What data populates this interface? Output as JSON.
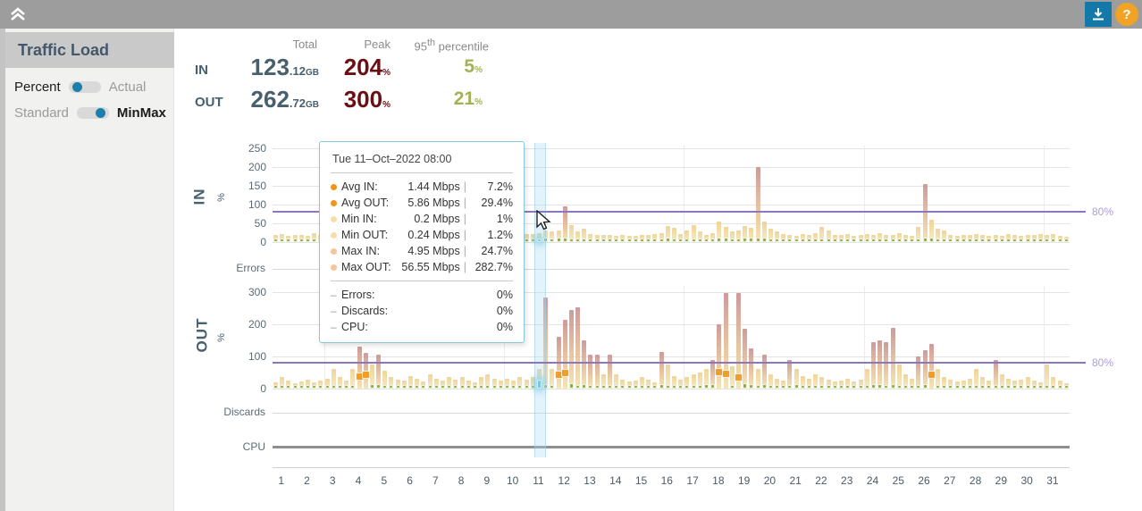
{
  "topbar": {
    "collapse_icon": "chevrons-up",
    "download_icon": "download",
    "help_label": "?"
  },
  "sidebar": {
    "title": "Traffic Load",
    "toggles": [
      {
        "left": "Percent",
        "right": "Actual",
        "selected": "left"
      },
      {
        "left": "Standard",
        "right": "MinMax",
        "selected": "right"
      }
    ]
  },
  "stats": {
    "columns": [
      "Total",
      "Peak",
      "95th percentile"
    ],
    "rows": [
      {
        "label": "IN",
        "total_int": "123",
        "total_frac": ".12",
        "total_unit": "GB",
        "peak": "204",
        "peak_unit": "%",
        "pct95": "5",
        "pct95_unit": "%"
      },
      {
        "label": "OUT",
        "total_int": "262",
        "total_frac": ".72",
        "total_unit": "GB",
        "peak": "300",
        "peak_unit": "%",
        "pct95": "21",
        "pct95_unit": "%"
      }
    ]
  },
  "tooltip": {
    "title": "Tue 11–Oct–2022 08:00",
    "rows": [
      {
        "marker": "avg",
        "label": "Avg IN:",
        "value": "1.44 Mbps",
        "pct": "7.2%"
      },
      {
        "marker": "avg",
        "label": "Avg OUT:",
        "value": "5.86 Mbps",
        "pct": "29.4%"
      },
      {
        "marker": "min",
        "label": "Min IN:",
        "value": "0.2 Mbps",
        "pct": "1%"
      },
      {
        "marker": "min",
        "label": "Min OUT:",
        "value": "0.24 Mbps",
        "pct": "1.2%"
      },
      {
        "marker": "max",
        "label": "Max IN:",
        "value": "4.95 Mbps",
        "pct": "24.7%"
      },
      {
        "marker": "max",
        "label": "Max OUT:",
        "value": "56.55 Mbps",
        "pct": "282.7%"
      }
    ],
    "footer_rows": [
      {
        "label": "Errors:",
        "pct": "0%"
      },
      {
        "label": "Discards:",
        "pct": "0%"
      },
      {
        "label": "CPU:",
        "pct": "0%"
      }
    ]
  },
  "chart_data": {
    "type": "bar",
    "title": "Traffic Load IN/OUT percent of interface capacity, October 2022",
    "days": [
      1,
      2,
      3,
      4,
      5,
      6,
      7,
      8,
      9,
      10,
      11,
      12,
      13,
      14,
      15,
      16,
      17,
      18,
      19,
      20,
      21,
      22,
      23,
      24,
      25,
      26,
      27,
      28,
      29,
      30,
      31
    ],
    "weekly_gridline_days": [
      3,
      10,
      17,
      24,
      31
    ],
    "slots_per_day": 4,
    "highlight_slot": 41,
    "threshold_pct": 80,
    "threshold_label": "80%",
    "in": {
      "axis_label": "IN",
      "axis_unit": "%",
      "ticks": [
        250,
        200,
        150,
        100,
        50,
        0
      ],
      "ylim": [
        0,
        262
      ],
      "avg_pct_per_day": [
        [
          8,
          9,
          8,
          10
        ],
        [
          9,
          8,
          10,
          9
        ],
        [
          8,
          10,
          9,
          8
        ],
        [
          10,
          12,
          11,
          9
        ],
        [
          9,
          8,
          9,
          10
        ],
        [
          8,
          9,
          8,
          9
        ],
        [
          10,
          9,
          8,
          9
        ],
        [
          9,
          10,
          9,
          8
        ],
        [
          8,
          9,
          10,
          9
        ],
        [
          9,
          8,
          9,
          10
        ],
        [
          9,
          8,
          12,
          10
        ],
        [
          11,
          13,
          10,
          9
        ],
        [
          10,
          9,
          8,
          9
        ],
        [
          9,
          8,
          9,
          8
        ],
        [
          8,
          9,
          8,
          10
        ],
        [
          9,
          11,
          10,
          8
        ],
        [
          9,
          10,
          9,
          8
        ],
        [
          10,
          12,
          11,
          9
        ],
        [
          10,
          11,
          13,
          12
        ],
        [
          11,
          9,
          8,
          9
        ],
        [
          9,
          8,
          9,
          8
        ],
        [
          8,
          10,
          9,
          8
        ],
        [
          9,
          8,
          8,
          9
        ],
        [
          9,
          10,
          9,
          8
        ],
        [
          10,
          9,
          8,
          9
        ],
        [
          10,
          13,
          11,
          9
        ],
        [
          9,
          8,
          9,
          8
        ],
        [
          8,
          9,
          10,
          8
        ],
        [
          9,
          8,
          9,
          8
        ],
        [
          8,
          9,
          8,
          9
        ],
        [
          9,
          8,
          10,
          8
        ]
      ],
      "max_pct_per_day": [
        [
          18,
          22,
          16,
          20
        ],
        [
          20,
          17,
          23,
          19
        ],
        [
          17,
          25,
          20,
          16
        ],
        [
          25,
          45,
          35,
          22
        ],
        [
          20,
          16,
          19,
          22
        ],
        [
          16,
          20,
          17,
          21
        ],
        [
          22,
          18,
          16,
          19
        ],
        [
          19,
          30,
          21,
          16
        ],
        [
          17,
          21,
          24,
          18
        ],
        [
          20,
          16,
          19,
          22
        ],
        [
          22,
          25,
          32,
          28
        ],
        [
          30,
          95,
          45,
          28
        ],
        [
          35,
          22,
          18,
          20
        ],
        [
          19,
          16,
          20,
          17
        ],
        [
          16,
          20,
          18,
          22
        ],
        [
          25,
          42,
          38,
          22
        ],
        [
          30,
          45,
          28,
          20
        ],
        [
          25,
          55,
          40,
          28
        ],
        [
          30,
          42,
          38,
          200
        ],
        [
          55,
          35,
          28,
          22
        ],
        [
          20,
          17,
          21,
          18
        ],
        [
          25,
          40,
          30,
          20
        ],
        [
          18,
          21,
          17,
          20
        ],
        [
          22,
          18,
          24,
          19
        ],
        [
          20,
          23,
          18,
          16
        ],
        [
          40,
          155,
          60,
          35
        ],
        [
          30,
          20,
          17,
          19
        ],
        [
          18,
          22,
          19,
          16
        ],
        [
          20,
          17,
          21,
          18
        ],
        [
          16,
          20,
          18,
          21
        ],
        [
          19,
          22,
          17,
          15
        ]
      ]
    },
    "out": {
      "axis_label": "OUT",
      "axis_unit": "%",
      "ticks": [
        300,
        200,
        100,
        0
      ],
      "ylim": [
        0,
        320
      ],
      "avg_pct_per_day": [
        [
          9,
          10,
          9,
          11
        ],
        [
          10,
          9,
          11,
          10
        ],
        [
          9,
          12,
          10,
          9
        ],
        [
          12,
          50,
          55,
          14
        ],
        [
          15,
          10,
          9,
          11
        ],
        [
          9,
          11,
          10,
          9
        ],
        [
          12,
          10,
          9,
          10
        ],
        [
          10,
          11,
          9,
          10
        ],
        [
          9,
          12,
          11,
          9
        ],
        [
          10,
          9,
          10,
          12
        ],
        [
          10,
          29,
          14,
          11
        ],
        [
          55,
          60,
          16,
          12
        ],
        [
          14,
          11,
          10,
          9
        ],
        [
          12,
          9,
          10,
          9
        ],
        [
          9,
          10,
          9,
          11
        ],
        [
          14,
          11,
          10,
          9
        ],
        [
          10,
          11,
          12,
          13
        ],
        [
          14,
          65,
          58,
          12
        ],
        [
          48,
          16,
          14,
          11
        ],
        [
          13,
          10,
          9,
          10
        ],
        [
          12,
          13,
          10,
          9
        ],
        [
          10,
          9,
          11,
          9
        ],
        [
          9,
          10,
          9,
          10
        ],
        [
          11,
          13,
          14,
          12
        ],
        [
          15,
          11,
          10,
          9
        ],
        [
          12,
          14,
          55,
          10
        ],
        [
          9,
          10,
          9,
          9
        ],
        [
          10,
          12,
          10,
          9
        ],
        [
          12,
          10,
          9,
          10
        ],
        [
          9,
          11,
          9,
          10
        ],
        [
          12,
          9,
          10,
          8
        ]
      ],
      "max_pct_per_day": [
        [
          20,
          35,
          25,
          18
        ],
        [
          22,
          28,
          20,
          25
        ],
        [
          30,
          60,
          35,
          25
        ],
        [
          60,
          130,
          110,
          75
        ],
        [
          105,
          55,
          35,
          28
        ],
        [
          25,
          40,
          30,
          22
        ],
        [
          45,
          30,
          25,
          35
        ],
        [
          28,
          35,
          25,
          20
        ],
        [
          35,
          45,
          30,
          25
        ],
        [
          30,
          25,
          35,
          28
        ],
        [
          35,
          60,
          283,
          60
        ],
        [
          160,
          215,
          245,
          253
        ],
        [
          150,
          105,
          105,
          45
        ],
        [
          105,
          45,
          28,
          22
        ],
        [
          25,
          35,
          28,
          20
        ],
        [
          115,
          75,
          40,
          28
        ],
        [
          35,
          45,
          50,
          60
        ],
        [
          90,
          200,
          297,
          70
        ],
        [
          296,
          185,
          125,
          60
        ],
        [
          105,
          45,
          30,
          25
        ],
        [
          90,
          60,
          40,
          30
        ],
        [
          45,
          35,
          28,
          22
        ],
        [
          25,
          30,
          22,
          28
        ],
        [
          60,
          145,
          150,
          145
        ],
        [
          190,
          75,
          45,
          30
        ],
        [
          100,
          120,
          140,
          60
        ],
        [
          35,
          28,
          22,
          25
        ],
        [
          30,
          60,
          35,
          25
        ],
        [
          90,
          45,
          30,
          25
        ],
        [
          28,
          35,
          25,
          20
        ],
        [
          75,
          35,
          25,
          18
        ]
      ]
    },
    "aux_rows": [
      {
        "label": "Errors",
        "value_pct": 0
      },
      {
        "label": "Discards",
        "value_pct": 0
      },
      {
        "label": "CPU",
        "value_pct": 0
      }
    ]
  },
  "colors": {
    "topbar": "#9d9d9d",
    "download": "#1478a8",
    "help": "#f0a325",
    "accent": "#1b7fae",
    "maroon": "#6a1014",
    "olive": "#a4b152",
    "purple": "#8d76c0",
    "purple-label": "#ab9ddb",
    "green": "#8fad3f",
    "orange": "#f09d2a",
    "cyan": "#62c4da",
    "marker-avg": "#f0931f",
    "marker-min": "#f8dcae",
    "marker-max": "#f3c59c"
  }
}
